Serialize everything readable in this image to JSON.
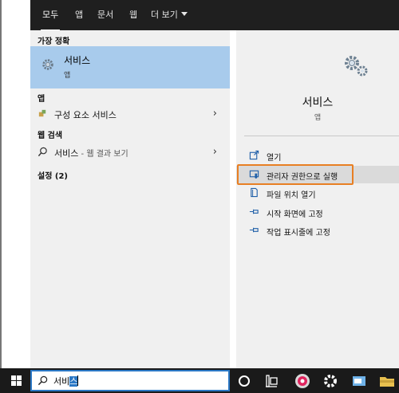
{
  "tabs": [
    {
      "label": "모두",
      "active": true
    },
    {
      "label": "앱"
    },
    {
      "label": "문서"
    },
    {
      "label": "웹"
    },
    {
      "label": "더 보기"
    }
  ],
  "left": {
    "best_match_heading": "가장 정확",
    "best_match": {
      "title": "서비스",
      "subtitle": "앱",
      "icon": "gear-icon"
    },
    "apps_heading": "앱",
    "app_item": {
      "label": "구성 요소 서비스",
      "icon": "component-services-icon"
    },
    "web_heading": "웹 검색",
    "web_item": {
      "label": "서비스",
      "hint": " - 웹 결과 보기",
      "icon": "search-icon"
    },
    "settings_heading": "설정 (2)"
  },
  "right": {
    "title": "서비스",
    "subtitle": "앱",
    "actions": [
      {
        "label": "열기",
        "icon": "open-icon"
      },
      {
        "label": "관리자 권한으로 실행",
        "icon": "run-as-admin-icon"
      },
      {
        "label": "파일 위치 열기",
        "icon": "file-location-icon"
      },
      {
        "label": "시작 화면에 고정",
        "icon": "pin-icon"
      },
      {
        "label": "작업 표시줄에 고정",
        "icon": "pin-icon"
      }
    ]
  },
  "search": {
    "typed": "서비",
    "selected": "스"
  },
  "colors": {
    "accent": "#2b78c5",
    "highlight": "#e87f23",
    "best_match_bg": "#a8cbec",
    "topbar": "#1f1f1f"
  }
}
